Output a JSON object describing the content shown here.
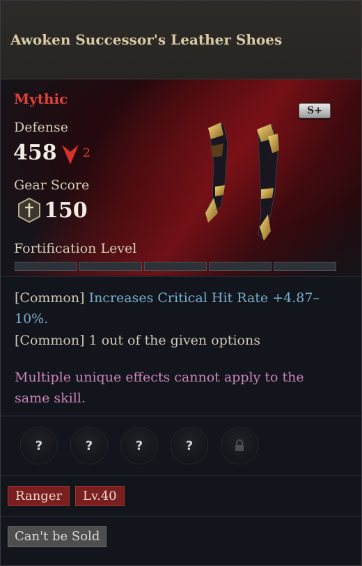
{
  "item": {
    "name": "Awoken Successor's Leather Shoes",
    "grade": "Mythic",
    "tier_badge": "S+",
    "defense_label": "Defense",
    "defense_value": "458",
    "defense_diff": "2",
    "gear_score_label": "Gear Score",
    "gear_score_value": "150",
    "fortification_label": "Fortification Level",
    "fortification_filled": 0,
    "fortification_total": 5
  },
  "options": [
    {
      "tag": "[Common]",
      "text": "Increases Critical Hit Rate +4.87–10%."
    },
    {
      "tag": "[Common]",
      "text": "1 out of the given options"
    }
  ],
  "warning": "Multiple unique effects cannot apply to the same skill.",
  "sockets": [
    {
      "glyph": "?",
      "icon": "question-icon"
    },
    {
      "glyph": "?",
      "icon": "question-icon"
    },
    {
      "glyph": "?",
      "icon": "question-icon"
    },
    {
      "glyph": "?",
      "icon": "question-icon"
    },
    {
      "glyph": "",
      "icon": "lock-icon"
    }
  ],
  "tags": {
    "class": "Ranger",
    "level": "Lv.40"
  },
  "sell_status": "Can't be Sold",
  "colors": {
    "grade": "#e0413a",
    "option_highlight": "#79aecd",
    "warning": "#c985b6",
    "requirement_tag": "#7a1f1f"
  }
}
